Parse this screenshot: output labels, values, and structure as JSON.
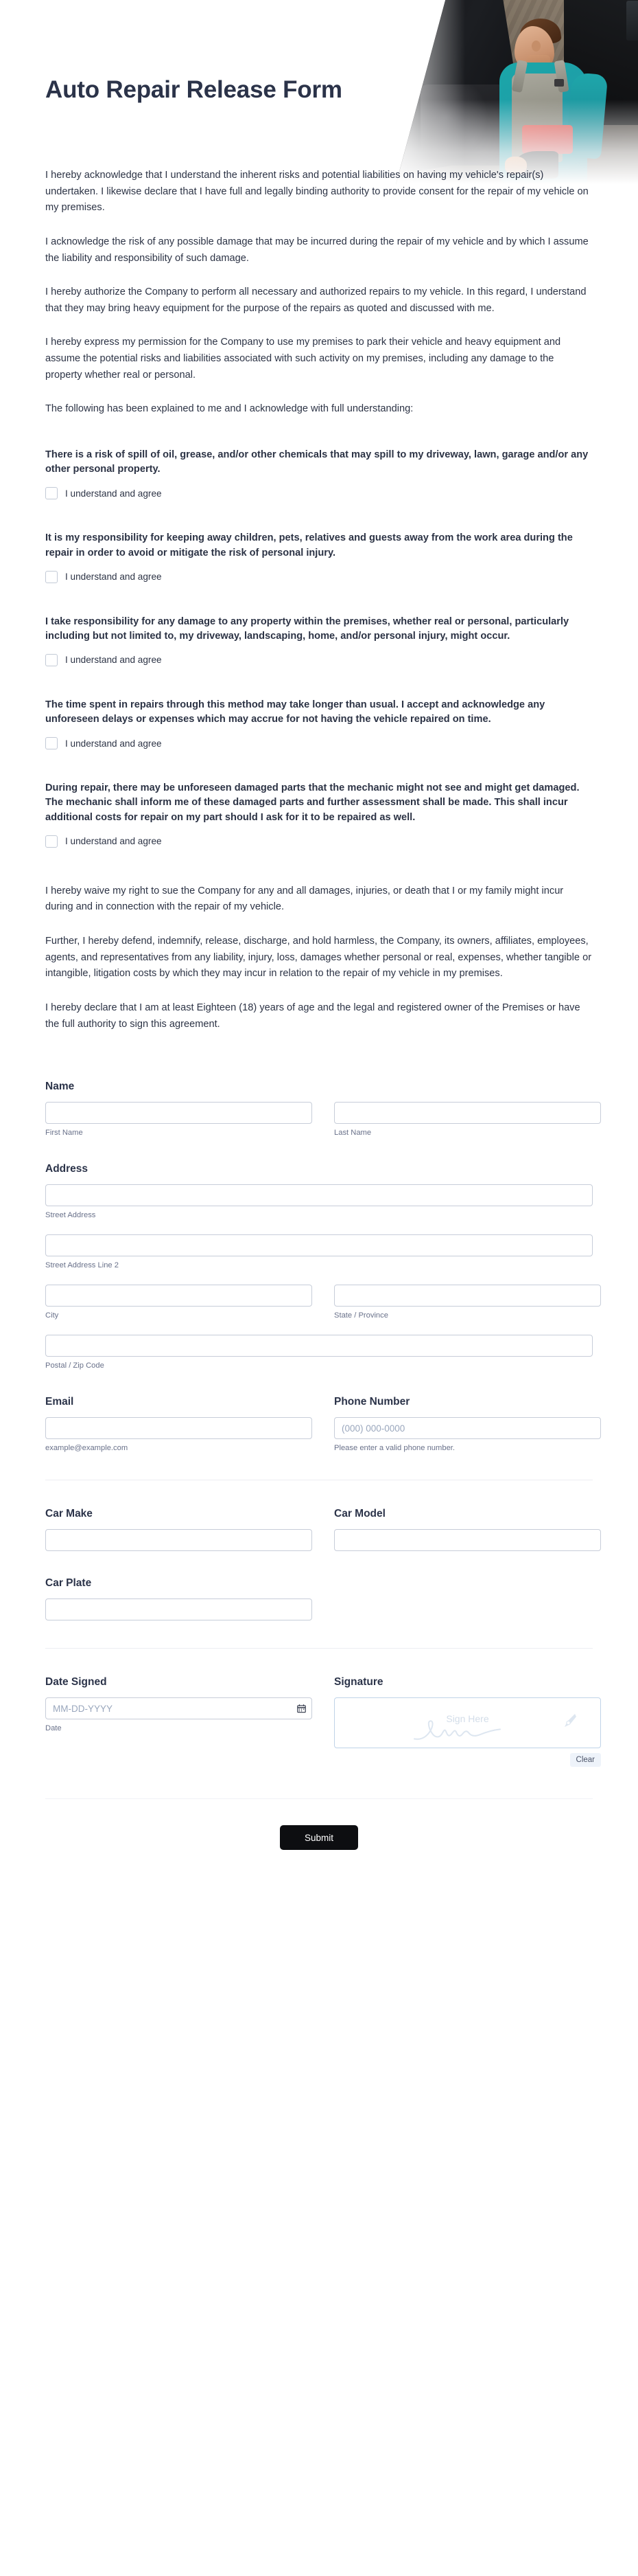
{
  "header": {
    "title": "Auto Repair Release Form",
    "hero_image_alt": "mechanic-in-garage-photo"
  },
  "intro_paragraphs": [
    "I hereby acknowledge that I understand the inherent risks and potential liabilities on having my vehicle's repair(s) undertaken. I likewise declare that I have full and legally binding authority to provide consent for the repair of my vehicle on my premises.",
    "I acknowledge the risk of any possible damage that may be incurred during the repair of my vehicle and by which I assume the liability and responsibility of such damage.",
    "I hereby authorize the Company to perform all necessary and authorized repairs to my vehicle. In this regard, I understand that they may bring heavy equipment for the purpose of the repairs as quoted and discussed with me.",
    "I hereby express my permission for the Company to use my premises to park their vehicle and heavy equipment and assume the potential risks and liabilities associated with such activity on my premises, including any damage to the property whether real or personal.",
    "The following has been explained to me and I acknowledge with full understanding:"
  ],
  "consents": [
    {
      "statement": "There is a risk of spill of oil, grease, and/or other chemicals that may spill to my driveway, lawn, garage and/or any other personal property.",
      "checkbox_label": "I understand and agree",
      "checked": false
    },
    {
      "statement": "It is my responsibility for keeping away children, pets, relatives and guests away from the work area during the repair in order to avoid or mitigate the risk of personal injury.",
      "checkbox_label": "I understand and agree",
      "checked": false
    },
    {
      "statement": "I take responsibility for any damage to any property within the premises, whether real or personal, particularly including but not limited to, my driveway, landscaping, home, and/or personal injury, might occur.",
      "checkbox_label": "I understand and agree",
      "checked": false
    },
    {
      "statement": "The time spent in repairs through this method may take longer than usual. I accept and acknowledge any unforeseen delays or expenses which may accrue for not having the vehicle repaired on time.",
      "checkbox_label": "I understand and agree",
      "checked": false
    },
    {
      "statement": "During repair, there may be unforeseen damaged parts that the mechanic might not see and might get damaged. The mechanic shall inform me of these damaged parts and further assessment shall be made. This shall incur additional costs for repair on my part should I ask for it to be repaired as well.",
      "checkbox_label": "I understand and agree",
      "checked": false
    }
  ],
  "outro_paragraphs": [
    "I hereby waive my right to sue the Company for any and all damages, injuries, or death that I or my family might incur during and in connection with the repair of my vehicle.",
    "Further, I hereby defend, indemnify, release, discharge, and hold harmless, the Company, its owners, affiliates, employees, agents, and representatives from any liability, injury, loss, damages whether personal or real, expenses, whether tangible or intangible, litigation costs by which they may incur in relation to the repair of my vehicle in my premises.",
    "I hereby declare that I am at least Eighteen (18) years of age and the legal and registered owner of the Premises or have the full authority to sign this agreement."
  ],
  "fields": {
    "name": {
      "label": "Name",
      "first": {
        "value": "",
        "placeholder": "",
        "sub_label": "First Name"
      },
      "last": {
        "value": "",
        "placeholder": "",
        "sub_label": "Last Name"
      }
    },
    "address": {
      "label": "Address",
      "street": {
        "value": "",
        "placeholder": "",
        "sub_label": "Street Address"
      },
      "street2": {
        "value": "",
        "placeholder": "",
        "sub_label": "Street Address Line 2"
      },
      "city": {
        "value": "",
        "placeholder": "",
        "sub_label": "City"
      },
      "state": {
        "value": "",
        "placeholder": "",
        "sub_label": "State / Province"
      },
      "postal": {
        "value": "",
        "placeholder": "",
        "sub_label": "Postal / Zip Code"
      }
    },
    "email": {
      "label": "Email",
      "value": "",
      "placeholder": "",
      "sub_label": "example@example.com"
    },
    "phone": {
      "label": "Phone Number",
      "value": "",
      "placeholder": "(000) 000-0000",
      "sub_label": "Please enter a valid phone number."
    },
    "car_make": {
      "label": "Car Make",
      "value": "",
      "placeholder": ""
    },
    "car_model": {
      "label": "Car Model",
      "value": "",
      "placeholder": ""
    },
    "car_plate": {
      "label": "Car Plate",
      "value": "",
      "placeholder": ""
    },
    "date_signed": {
      "label": "Date Signed",
      "value": "",
      "placeholder": "MM-DD-YYYY",
      "sub_label": "Date",
      "icon": "calendar-icon"
    },
    "signature": {
      "label": "Signature",
      "placeholder_text": "Sign Here",
      "clear_label": "Clear",
      "pen_icon": "pen-nib-icon"
    }
  },
  "submit": {
    "label": "Submit"
  },
  "colors": {
    "heading": "#2b3349",
    "body_text": "#2c3345",
    "sub_label": "#69718a",
    "input_border": "#c7cdd9",
    "signature_border": "#bfd3e8",
    "submit_bg": "#0d0e11",
    "submit_text": "#ffffff",
    "clear_bg": "#eef3fa"
  }
}
